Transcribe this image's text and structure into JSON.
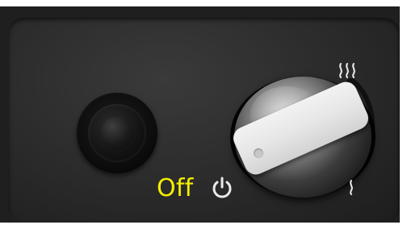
{
  "panel": {
    "off_label": "Off"
  },
  "icons": {
    "power": "power-icon",
    "heat_high": "heat-high-icon",
    "heat_low": "heat-low-icon"
  },
  "colors": {
    "off_label": "#f5f000",
    "panel_background": "#2a2a2a",
    "knob_pointer": "#e6e6e6"
  }
}
